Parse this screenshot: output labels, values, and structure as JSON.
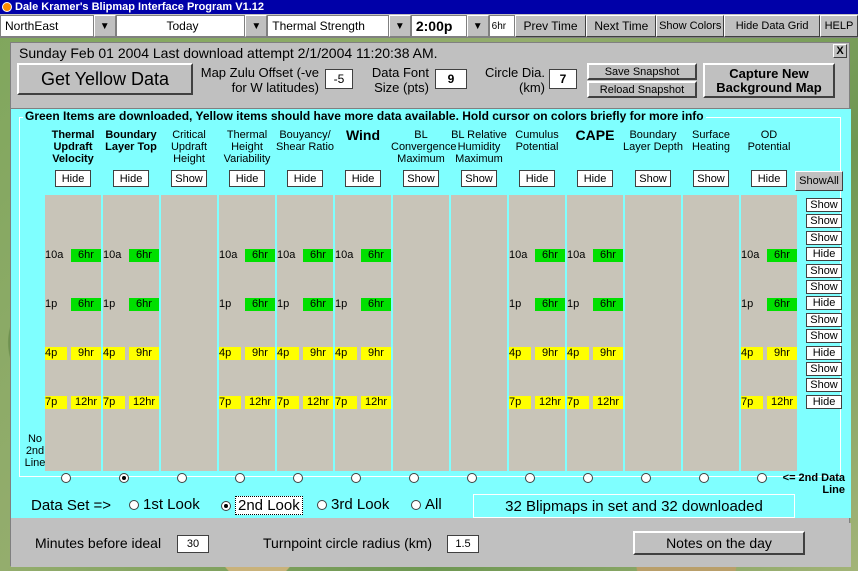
{
  "window": {
    "title": "Dale Kramer's Blipmap Interface Program V1.12"
  },
  "toolbar": {
    "region": "NorthEast",
    "day": "Today",
    "parameter": "Thermal Strength",
    "time": "2:00p",
    "age": "6hr",
    "prev_time": "Prev Time",
    "next_time": "Next Time",
    "show_colors": "Show Colors",
    "hide_data_grid": "Hide Data Grid",
    "help": "HELP"
  },
  "panel": {
    "close": "X",
    "header": "Sunday Feb 01 2004 Last download attempt 2/1/2004 11:20:38 AM.",
    "get_yellow": "Get Yellow Data",
    "zulu_label": "Map Zulu Offset (-ve for W latitudes)",
    "zulu_value": "-5",
    "font_label": "Data Font Size (pts)",
    "font_value": "9",
    "circle_label": "Circle Dia. (km)",
    "circle_value": "7",
    "save_snapshot": "Save Snapshot",
    "reload_snapshot": "Reload Snapshot",
    "capture_map": "Capture New Background Map"
  },
  "grid": {
    "caption": "Green Items are downloaded, Yellow items should have more data available.  Hold cursor on colors briefly for more info",
    "columns": [
      {
        "label": "Thermal Updraft Velocity",
        "button": "Hide",
        "style": "bold"
      },
      {
        "label": "Boundary Layer Top",
        "button": "Hide",
        "style": "bold"
      },
      {
        "label": "Critical Updraft Height",
        "button": "Show",
        "style": ""
      },
      {
        "label": "Thermal Height Variability",
        "button": "Hide",
        "style": ""
      },
      {
        "label": "Bouyancy/ Shear Ratio",
        "button": "Hide",
        "style": ""
      },
      {
        "label": "Wind",
        "button": "Hide",
        "style": "big"
      },
      {
        "label": "BL Convergence Maximum",
        "button": "Show",
        "style": ""
      },
      {
        "label": "BL Relative Humidity Maximum",
        "button": "Show",
        "style": ""
      },
      {
        "label": "Cumulus Potential",
        "button": "Hide",
        "style": ""
      },
      {
        "label": "CAPE",
        "button": "Hide",
        "style": "big"
      },
      {
        "label": "Boundary Layer Depth",
        "button": "Show",
        "style": ""
      },
      {
        "label": "Surface Heating",
        "button": "Show",
        "style": ""
      },
      {
        "label": "OD Potential",
        "button": "Hide",
        "style": ""
      }
    ],
    "show_all": "ShowAll",
    "rows": [
      {
        "time": "10a",
        "age": "6hr",
        "color": "green"
      },
      {
        "time": "1p",
        "age": "6hr",
        "color": "green"
      },
      {
        "time": "4p",
        "age": "9hr",
        "color": "yellow"
      },
      {
        "time": "7p",
        "age": "12hr",
        "color": "yellow"
      }
    ],
    "side_buttons": [
      "Show",
      "Show",
      "Show",
      "Hide",
      "Show",
      "Show",
      "Hide",
      "Show",
      "Show",
      "Hide",
      "Show",
      "Show",
      "Hide"
    ],
    "no_2nd_line": "No 2nd Line",
    "second_line_label": "<= 2nd Data Line",
    "selected_radio": 2
  },
  "dataset": {
    "label": "Data Set =>",
    "options": [
      "1st Look",
      "2nd Look",
      "3rd Look",
      "All"
    ],
    "selected": "2nd Look",
    "status": "32 Blipmaps in set and 32 downloaded"
  },
  "bottom": {
    "minutes_label": "Minutes before ideal",
    "minutes_value": "30",
    "radius_label": "Turnpoint circle radius (km)",
    "radius_value": "1.5",
    "notes": "Notes on the day"
  },
  "colors": {
    "cyan": "#7fffff",
    "green": "#00e000",
    "yellow": "#ffff00",
    "title": "#0000a8"
  }
}
